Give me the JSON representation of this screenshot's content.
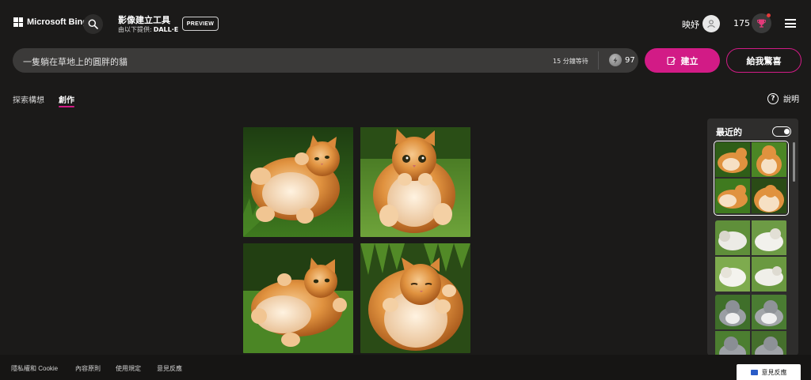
{
  "header": {
    "brand": "Microsoft Bing",
    "app_title": "影像建立工具",
    "provider_prefix": "由以下提供:",
    "provider": "DALL·E",
    "preview_badge": "PREVIEW",
    "user_name": "映妤",
    "points": "175"
  },
  "prompt": {
    "text": "一隻躺在草地上的圓胖的貓",
    "wait_time": "15 分鐘等待",
    "boosts": "97",
    "create_label": "建立",
    "surprise_label": "給我驚喜"
  },
  "tabs": {
    "explore": "探索構想",
    "create": "創作",
    "active": "create"
  },
  "help_label": "說明",
  "recent": {
    "title": "最近的",
    "toggle_on": true
  },
  "footer": {
    "links": [
      "隱私權和 Cookie",
      "內容原則",
      "使用規定",
      "意見反應"
    ],
    "feedback_button": "意見反應"
  },
  "colors": {
    "accent": "#d21b86",
    "background": "#1b1a19",
    "input": "#3b3a39"
  },
  "icons": {
    "search": "search-icon",
    "avatar": "user-avatar-icon",
    "rewards": "rewards-trophy-icon",
    "menu": "hamburger-menu-icon",
    "boost": "boost-coin-icon",
    "create": "create-edit-icon",
    "help": "help-circle-icon",
    "feedback": "feedback-chat-icon"
  }
}
